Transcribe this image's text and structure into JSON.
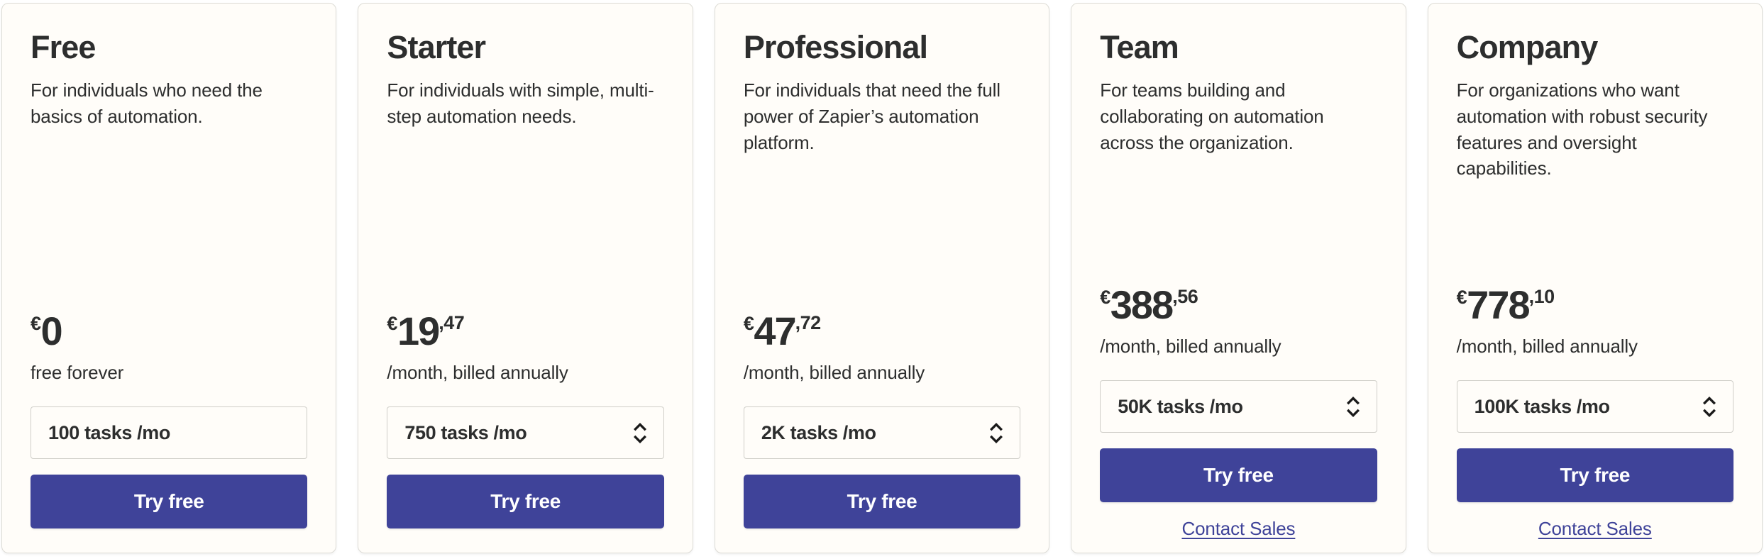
{
  "theme": {
    "card_bg": "#FFFDF9",
    "card_border": "#DDDCD6",
    "text": "#2D2E2E",
    "accent": "#3F4399",
    "button_text": "#FFFFFF",
    "select_border": "#CFCEC8",
    "page_bg": "#FFFFFF"
  },
  "plans": [
    {
      "name": "Free",
      "description": "For individuals who need the basics of automation.",
      "currency": "€",
      "amount": "0",
      "cents": "",
      "billing_note": "free forever",
      "task_option": "100 tasks /mo",
      "has_stepper": false,
      "cta_label": "Try free",
      "contact_label": null
    },
    {
      "name": "Starter",
      "description": "For individuals with simple, multi-step automation needs.",
      "currency": "€",
      "amount": "19",
      "cents": ",47",
      "billing_note": "/month, billed annually",
      "task_option": "750 tasks /mo",
      "has_stepper": true,
      "cta_label": "Try free",
      "contact_label": null
    },
    {
      "name": "Professional",
      "description": "For individuals that need the full power of Zapier’s automation platform.",
      "currency": "€",
      "amount": "47",
      "cents": ",72",
      "billing_note": "/month, billed annually",
      "task_option": "2K tasks /mo",
      "has_stepper": true,
      "cta_label": "Try free",
      "contact_label": null
    },
    {
      "name": "Team",
      "description": "For teams building and collaborating on automation across the organization.",
      "currency": "€",
      "amount": "388",
      "cents": ",56",
      "billing_note": "/month, billed annually",
      "task_option": "50K tasks /mo",
      "has_stepper": true,
      "cta_label": "Try free",
      "contact_label": "Contact Sales"
    },
    {
      "name": "Company",
      "description": "For organizations who want automation with robust security features and oversight capabilities.",
      "currency": "€",
      "amount": "778",
      "cents": ",10",
      "billing_note": "/month, billed annually",
      "task_option": "100K tasks /mo",
      "has_stepper": true,
      "cta_label": "Try free",
      "contact_label": "Contact Sales"
    }
  ],
  "icons": {
    "stepper": "chevron-up-down-icon"
  }
}
